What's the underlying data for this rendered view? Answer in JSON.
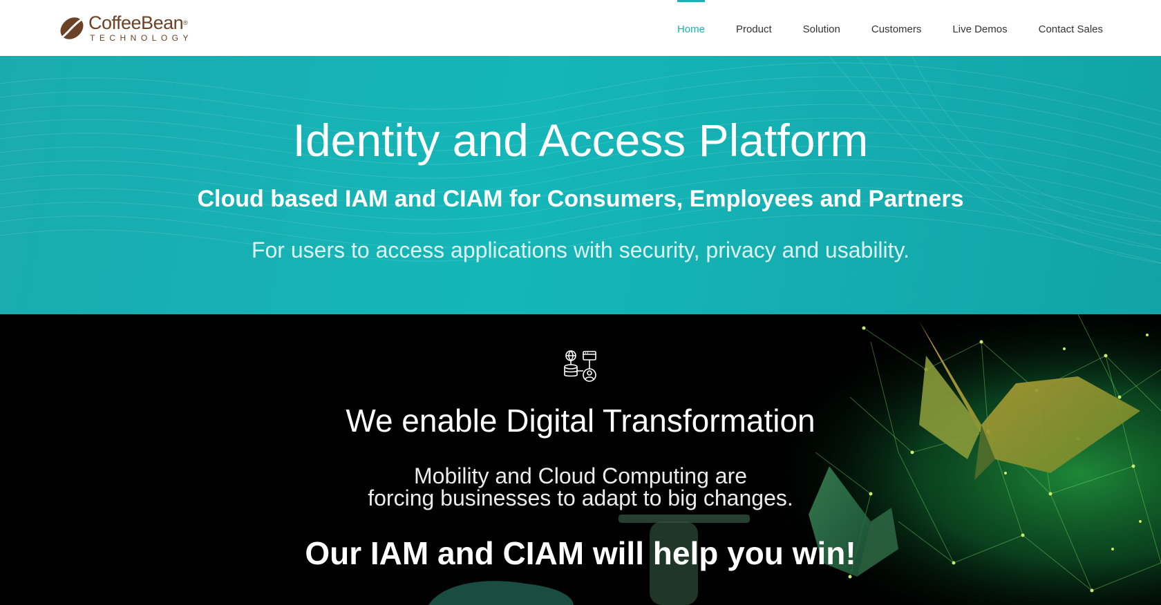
{
  "brand": {
    "name": "CoffeeBean",
    "registered": "®",
    "tagline": "TECHNOLOGY",
    "color": "#6b4226"
  },
  "nav": {
    "items": [
      {
        "label": "Home",
        "active": true
      },
      {
        "label": "Product",
        "active": false
      },
      {
        "label": "Solution",
        "active": false
      },
      {
        "label": "Customers",
        "active": false
      },
      {
        "label": "Live Demos",
        "active": false
      },
      {
        "label": "Contact Sales",
        "active": false
      }
    ],
    "accent": "#16b4b8"
  },
  "hero": {
    "title": "Identity and Access Platform",
    "subtitle": "Cloud based IAM and CIAM for Consumers, Employees and Partners",
    "description": "For users to access applications with security, privacy and usability.",
    "background": "#15b1b4"
  },
  "feature": {
    "icon": "network-database-icon",
    "title": "We enable Digital Transformation",
    "description_line1": "Mobility and Cloud Computing are",
    "description_line2": "forcing businesses to adapt to big changes.",
    "cta": "Our IAM and CIAM will help you win!"
  }
}
